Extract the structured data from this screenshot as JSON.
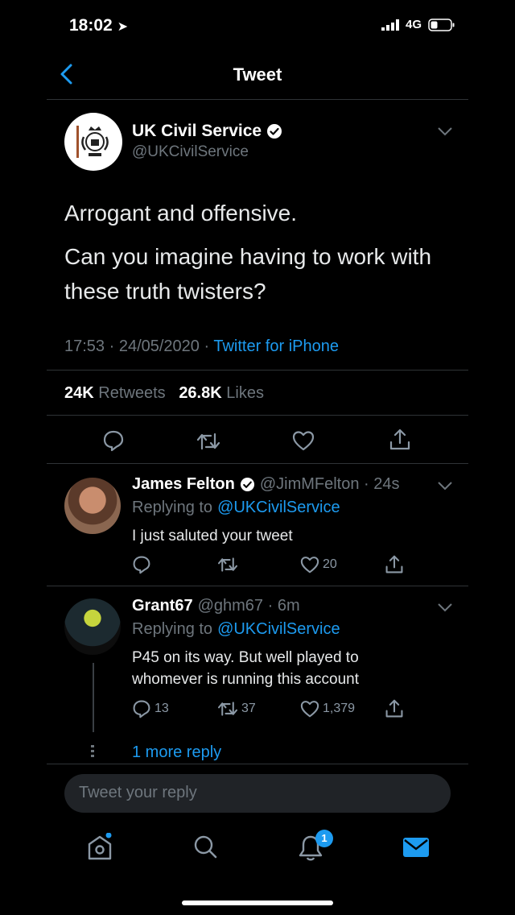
{
  "status_bar": {
    "time": "18:02",
    "network": "4G"
  },
  "header": {
    "title": "Tweet"
  },
  "tweet": {
    "author_name": "UK Civil Service",
    "author_handle": "@UKCivilService",
    "text_line1": "Arrogant and offensive.",
    "text_line2a": "Can you imagine having to work with",
    "text_line2b": "these truth twisters?",
    "time": "17:53 · 24/05/2020 ·",
    "source": "Twitter for iPhone",
    "retweets_count": "24K",
    "retweets_label": "Retweets",
    "likes_count": "26.8K",
    "likes_label": "Likes"
  },
  "replies": [
    {
      "name": "James Felton",
      "handle": "@JimMFelton · 24s",
      "replying_prefix": "Replying to",
      "replying_to": "@UKCivilService",
      "text": "I just saluted your tweet",
      "reply_count": "",
      "retweet_count": "",
      "like_count": "20"
    },
    {
      "name": "Grant67",
      "handle": "@ghm67 · 6m",
      "replying_prefix": "Replying to",
      "replying_to": "@UKCivilService",
      "text_line1": "P45 on its way. But well played to",
      "text_line2": "whomever is running this account",
      "reply_count": "13",
      "retweet_count": "37",
      "like_count": "1,379"
    }
  ],
  "more_replies": "1 more reply",
  "reply_box": {
    "placeholder": "Tweet your reply"
  },
  "tab_bar": {
    "notifications_badge": "1"
  },
  "icons": [
    "back-chevron-icon",
    "verified-icon",
    "chevron-down-icon",
    "reply-icon",
    "retweet-icon",
    "like-icon",
    "share-icon",
    "home-icon",
    "search-icon",
    "notifications-icon",
    "messages-icon"
  ],
  "colors": {
    "accent": "#1d9bf0",
    "background": "#000000",
    "muted": "#6e767d"
  }
}
